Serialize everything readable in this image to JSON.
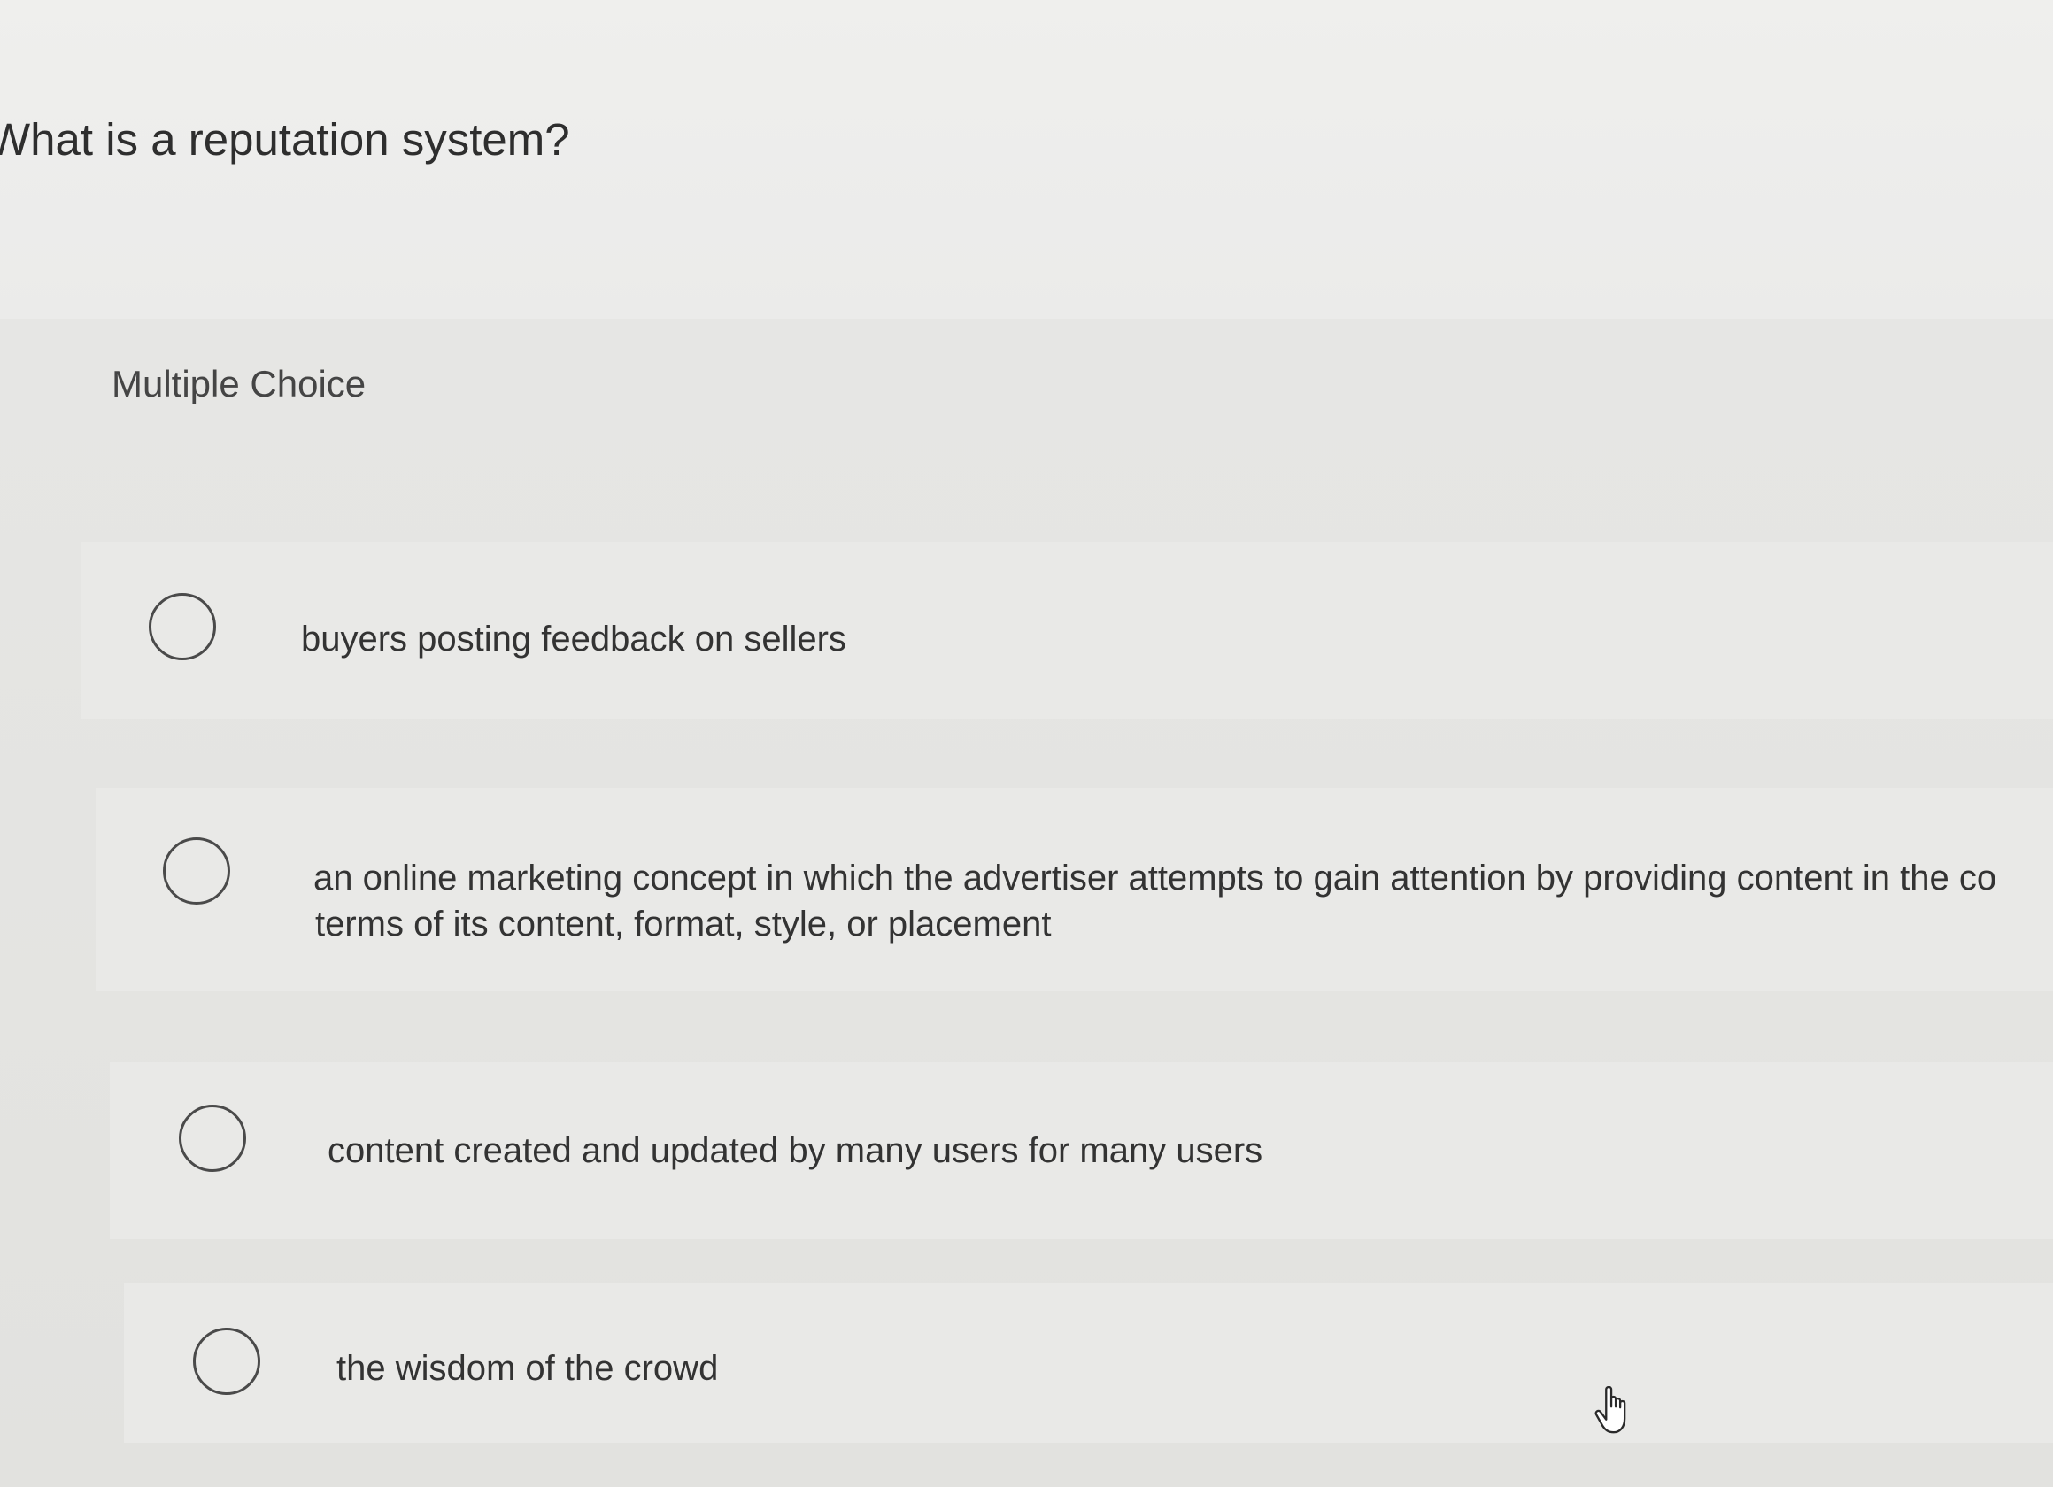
{
  "question": {
    "text": "What is a reputation system?"
  },
  "section": {
    "label": "Multiple Choice"
  },
  "choices": [
    {
      "label": "buyers posting feedback on sellers",
      "selected": false
    },
    {
      "line1": "an online marketing concept in which the advertiser attempts to gain attention by providing content in the co",
      "line2": "terms of its content, format, style, or placement",
      "selected": false
    },
    {
      "label": "content created and updated by many users for many users",
      "selected": false
    },
    {
      "label": "the wisdom of the crowd",
      "selected": false
    }
  ],
  "icons": {
    "radio": "radio-unselected-icon",
    "cursor": "hand-pointer-icon"
  },
  "colors": {
    "background": "#e4e4e2",
    "text": "#333333",
    "radio_border": "#4a4a4a"
  }
}
